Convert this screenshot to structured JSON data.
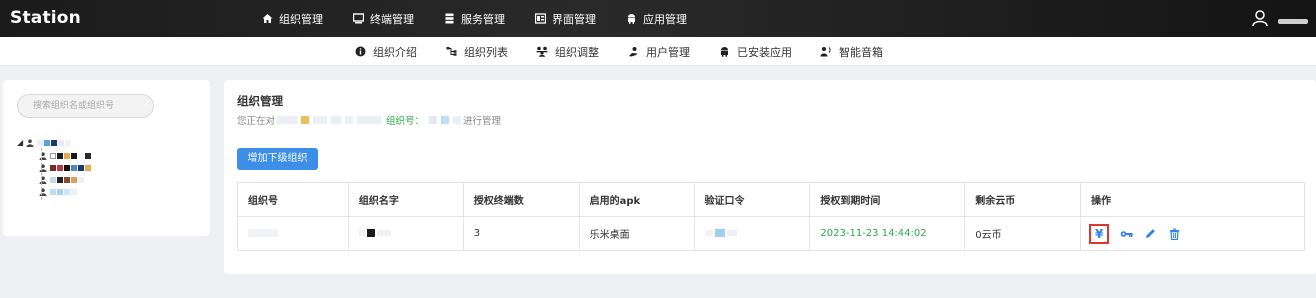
{
  "app": {
    "logo": "Station"
  },
  "topnav": [
    {
      "label": "组织管理",
      "icon": "home-icon"
    },
    {
      "label": "终端管理",
      "icon": "monitor-icon"
    },
    {
      "label": "服务管理",
      "icon": "server-icon"
    },
    {
      "label": "界面管理",
      "icon": "layout-icon"
    },
    {
      "label": "应用管理",
      "icon": "android-icon"
    }
  ],
  "subnav": [
    {
      "label": "组织介绍",
      "icon": "info-icon"
    },
    {
      "label": "组织列表",
      "icon": "sitemap-icon"
    },
    {
      "label": "组织调整",
      "icon": "users-adjust-icon"
    },
    {
      "label": "用户管理",
      "icon": "user-manage-icon"
    },
    {
      "label": "已安装应用",
      "icon": "android-icon"
    },
    {
      "label": "智能音箱",
      "icon": "speaker-user-icon"
    }
  ],
  "sidebar": {
    "search_placeholder": "搜索组织名或组织号"
  },
  "main": {
    "title": "组织管理",
    "subtitle_prefix": "您正在对",
    "subtitle_org_label": "组织号：",
    "subtitle_suffix": "进行管理",
    "add_button": "增加下级组织",
    "table": {
      "headers": [
        "组织号",
        "组织名字",
        "授权终端数",
        "启用的apk",
        "验证口令",
        "授权到期时间",
        "剩余云币",
        "操作"
      ],
      "rows": [
        {
          "terminals": "3",
          "apk": "乐米桌面",
          "expire": "2023-11-23 14:44:02",
          "coins": "0云币"
        }
      ]
    },
    "ops": [
      "yen-icon",
      "key-icon",
      "edit-icon",
      "trash-icon"
    ],
    "colors": {
      "accent": "#3d8ee6",
      "green": "#2aa84a",
      "highlight": "#e0342f"
    }
  }
}
